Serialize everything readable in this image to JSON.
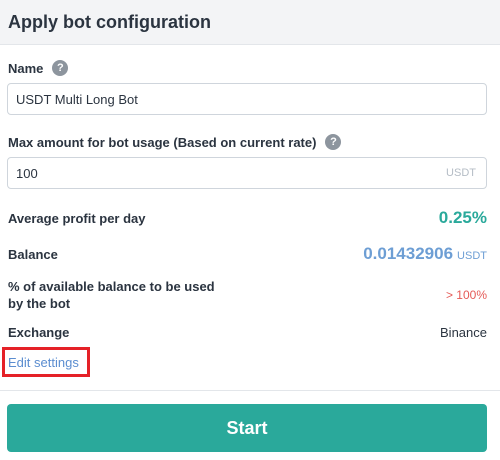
{
  "title": "Apply bot configuration",
  "name_field": {
    "label": "Name",
    "help_icon": "question-mark",
    "value": "USDT Multi Long Bot"
  },
  "amount_field": {
    "label": "Max amount for bot usage (Based on current rate)",
    "help_icon": "question-mark",
    "value": "100",
    "unit": "USDT"
  },
  "stats": {
    "avg_profit_label": "Average profit per day",
    "avg_profit_value": "0.25%",
    "balance_label": "Balance",
    "balance_value": "0.01432906",
    "balance_unit": "USDT",
    "pct_label_line1": "% of available balance to be used",
    "pct_label_line2": "by the bot",
    "pct_value": "> 100%",
    "exchange_label": "Exchange",
    "exchange_value": "Binance"
  },
  "edit_settings_label": "Edit settings",
  "start_button_label": "Start",
  "colors": {
    "accent": "#2aa99b",
    "balance": "#6d9ed4",
    "warning": "#e55a57",
    "highlight_box": "#e52128"
  }
}
